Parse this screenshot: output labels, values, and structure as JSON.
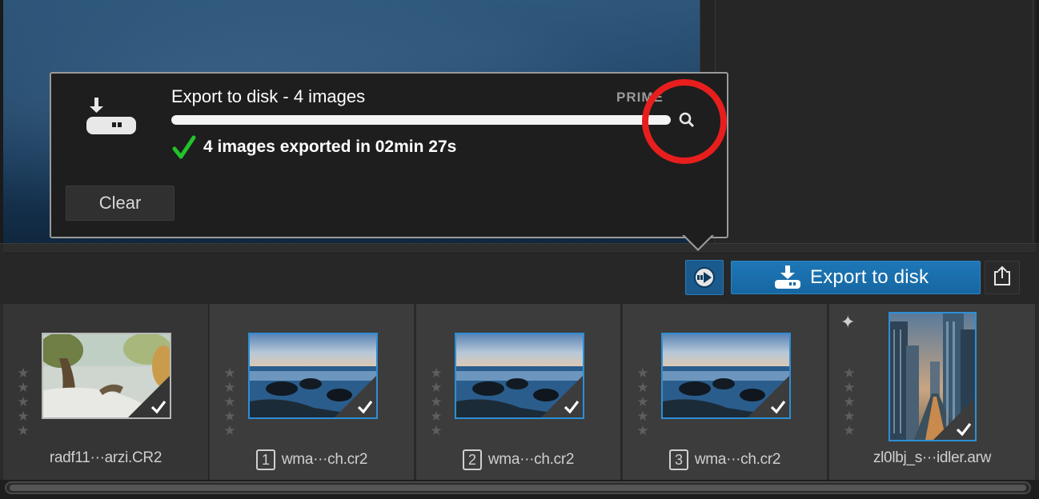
{
  "popover": {
    "title": "Export to disk - 4 images",
    "tag": "PRIME",
    "progress": 1.0,
    "status": "4 images exported in 02min 27s",
    "clear_label": "Clear"
  },
  "toolbar": {
    "export_label": "Export to disk"
  },
  "filmstrip": {
    "items": [
      {
        "filename": "radf11···arzi.CR2",
        "badge": "",
        "rating": 0,
        "selected": false,
        "exported": true
      },
      {
        "filename": "wma···ch.cr2",
        "badge": "1",
        "rating": 0,
        "selected": true,
        "exported": true
      },
      {
        "filename": "wma···ch.cr2",
        "badge": "2",
        "rating": 0,
        "selected": true,
        "exported": true
      },
      {
        "filename": "wma···ch.cr2",
        "badge": "3",
        "rating": 0,
        "selected": true,
        "exported": true
      },
      {
        "filename": "zl0lbj_s···idler.arw",
        "badge": "",
        "rating": 0,
        "selected": true,
        "exported": true
      }
    ]
  },
  "colors": {
    "accent": "#1e77b7",
    "success": "#22c32a",
    "annotation": "#e81e1e",
    "selection": "#2d8fd5"
  },
  "icons": {
    "export": "download-disk-icon",
    "activity": "activity-arrow-icon",
    "share": "share-icon",
    "search": "search-icon",
    "check": "checkmark-icon",
    "sparkle": "sparkle-icon"
  }
}
